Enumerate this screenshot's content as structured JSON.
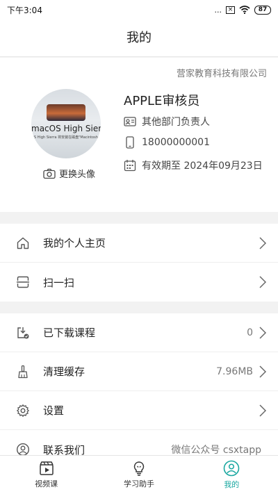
{
  "status_bar": {
    "time": "下午3:04",
    "dots": "...",
    "battery": "87"
  },
  "header": {
    "title": "我的"
  },
  "profile": {
    "company": "营家教育科技有限公司",
    "avatar_text_big": "macOS High Sierra",
    "avatar_text_small": "OS High Sierra 将安装在磁盘\"Macintosh HD\"",
    "change_avatar_label": "更换头像",
    "name": "APPLE审核员",
    "department": "其他部门负责人",
    "phone": "18000000001",
    "validity": "有效期至 2024年09月23日"
  },
  "menu_group_1": [
    {
      "label": "我的个人主页",
      "value": "",
      "icon": "home-icon"
    },
    {
      "label": "扫一扫",
      "value": "",
      "icon": "scan-icon"
    }
  ],
  "menu_group_2": [
    {
      "label": "已下载课程",
      "value": "0",
      "icon": "download-icon"
    },
    {
      "label": "清理缓存",
      "value": "7.96MB",
      "icon": "brush-icon"
    },
    {
      "label": "设置",
      "value": "",
      "icon": "gear-icon"
    },
    {
      "label": "联系我们",
      "value": "微信公众号 csxtapp",
      "icon": "contact-icon"
    }
  ],
  "tabs": [
    {
      "label": "视频课",
      "icon": "video-icon",
      "active": false
    },
    {
      "label": "学习助手",
      "icon": "lightbulb-icon",
      "active": false
    },
    {
      "label": "我的",
      "icon": "profile-icon",
      "active": true
    }
  ],
  "colors": {
    "accent": "#18a7a0",
    "background": "#f2f2f2"
  }
}
